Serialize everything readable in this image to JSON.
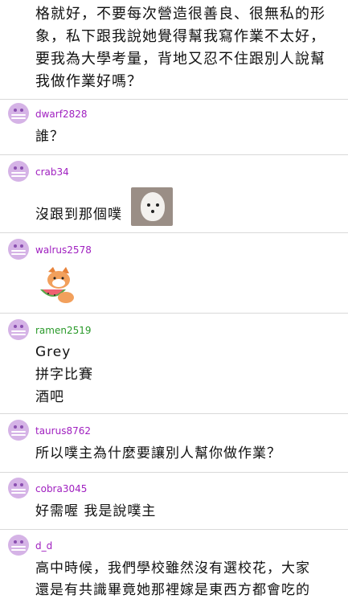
{
  "post": {
    "lines": [
      "格就好，不要每次營造很善良、很無私的形",
      "象，私下跟我說她覺得幫我寫作業不太好，",
      "要我為大學考量，背地又忍不住跟別人說幫",
      "我做作業好嗎？"
    ]
  },
  "comments": [
    {
      "user": "dwarf2828",
      "user_color": "#a020c0",
      "lines": [
        "誰？"
      ]
    },
    {
      "user": "crab34",
      "user_color": "#a020c0",
      "lines": [
        "沒跟到那個噗"
      ]
    },
    {
      "user": "walrus2578",
      "user_color": "#a020c0",
      "lines": []
    },
    {
      "user": "ramen2519",
      "user_color": "#2a9a2a",
      "lines": [
        "Grey",
        "拼字比賽",
        "酒吧"
      ]
    },
    {
      "user": "taurus8762",
      "user_color": "#a020c0",
      "lines": [
        "所以噗主為什麼要讓別人幫你做作業？"
      ]
    },
    {
      "user": "cobra3045",
      "user_color": "#a020c0",
      "lines": [
        "好需喔 我是說噗主"
      ]
    },
    {
      "user": "d_d",
      "user_color": "#a020c0",
      "lines": [
        "高中時候，我們學校雖然沒有選校花，大家",
        "還是有共識畢竟她那裡嫁是東西方都會吃的"
      ]
    }
  ],
  "icons": {
    "avatar": "default-avatar-icon",
    "dog": "dog-photo",
    "sticker": "fox-watermelon-sticker"
  }
}
